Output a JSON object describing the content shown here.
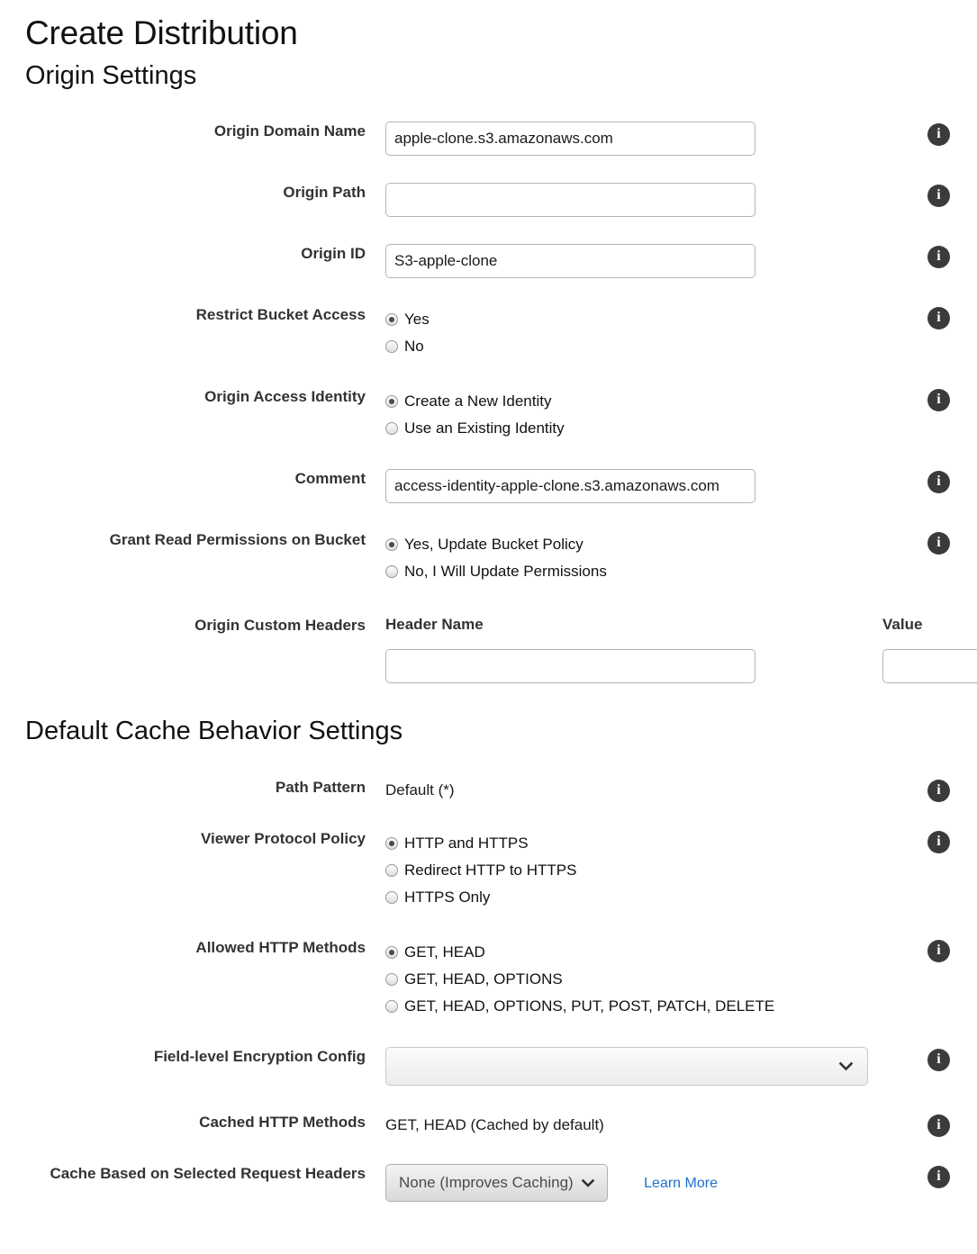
{
  "page": {
    "title": "Create Distribution"
  },
  "origin_settings": {
    "heading": "Origin Settings",
    "origin_domain_name": {
      "label": "Origin Domain Name",
      "value": "apple-clone.s3.amazonaws.com",
      "placeholder": ""
    },
    "origin_path": {
      "label": "Origin Path",
      "value": "",
      "placeholder": ""
    },
    "origin_id": {
      "label": "Origin ID",
      "value": "S3-apple-clone",
      "placeholder": ""
    },
    "restrict_bucket_access": {
      "label": "Restrict Bucket Access",
      "options": [
        {
          "label": "Yes",
          "selected": true
        },
        {
          "label": "No",
          "selected": false
        }
      ]
    },
    "origin_access_identity": {
      "label": "Origin Access Identity",
      "options": [
        {
          "label": "Create a New Identity",
          "selected": true
        },
        {
          "label": "Use an Existing Identity",
          "selected": false
        }
      ]
    },
    "comment": {
      "label": "Comment",
      "value": "access-identity-apple-clone.s3.amazonaws.com",
      "placeholder": ""
    },
    "grant_read_permissions": {
      "label": "Grant Read Permissions on Bucket",
      "options": [
        {
          "label": "Yes, Update Bucket Policy",
          "selected": true
        },
        {
          "label": "No, I Will Update Permissions",
          "selected": false
        }
      ]
    },
    "origin_custom_headers": {
      "label": "Origin Custom Headers",
      "column_header_name": "Header Name",
      "column_value": "Value",
      "rows": [
        {
          "header_name": "",
          "value": ""
        }
      ]
    }
  },
  "cache_behavior": {
    "heading": "Default Cache Behavior Settings",
    "path_pattern": {
      "label": "Path Pattern",
      "value": "Default (*)"
    },
    "viewer_protocol_policy": {
      "label": "Viewer Protocol Policy",
      "options": [
        {
          "label": "HTTP and HTTPS",
          "selected": true
        },
        {
          "label": "Redirect HTTP to HTTPS",
          "selected": false
        },
        {
          "label": "HTTPS Only",
          "selected": false
        }
      ]
    },
    "allowed_http_methods": {
      "label": "Allowed HTTP Methods",
      "options": [
        {
          "label": "GET, HEAD",
          "selected": true
        },
        {
          "label": "GET, HEAD, OPTIONS",
          "selected": false
        },
        {
          "label": "GET, HEAD, OPTIONS, PUT, POST, PATCH, DELETE",
          "selected": false
        }
      ]
    },
    "field_level_encryption": {
      "label": "Field-level Encryption Config",
      "selected_value": "",
      "chevron": "⌄"
    },
    "cached_http_methods": {
      "label": "Cached HTTP Methods",
      "value": "GET, HEAD (Cached by default)"
    },
    "cache_based_on_headers": {
      "label": "Cache Based on Selected Request Headers",
      "selected_value": "None (Improves Caching)",
      "chevron": "⌄",
      "learn_more": "Learn More"
    }
  },
  "icons": {
    "info": "i"
  },
  "colors": {
    "link": "#1f6fce",
    "label": "#333333",
    "info_badge": "#3b3b3b"
  }
}
